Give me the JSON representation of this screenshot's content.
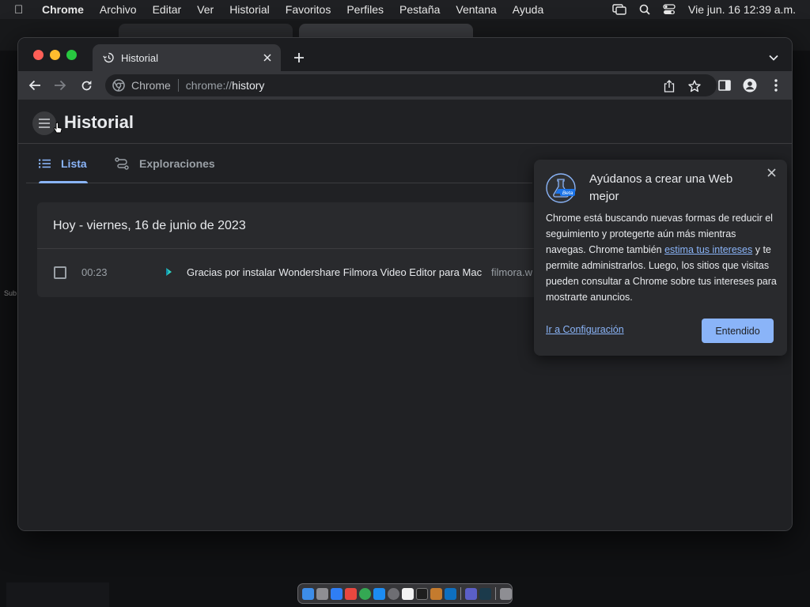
{
  "menubar": {
    "app": "Chrome",
    "items": [
      "Archivo",
      "Editar",
      "Ver",
      "Historial",
      "Favoritos",
      "Perfiles",
      "Pestaña",
      "Ventana",
      "Ayuda"
    ],
    "datetime": "Vie jun. 16  12:39 a.m."
  },
  "background": {
    "side_text": "Sub"
  },
  "window": {
    "tab": {
      "title": "Historial"
    },
    "omnibox": {
      "site_name": "Chrome",
      "url_scheme": "chrome://",
      "url_host": "history"
    }
  },
  "history": {
    "title": "Historial",
    "tabs": [
      {
        "label": "Lista",
        "active": true
      },
      {
        "label": "Exploraciones",
        "active": false
      }
    ],
    "day_header": "Hoy - viernes, 16 de junio de 2023",
    "entries": [
      {
        "time": "00:23",
        "title": "Gracias por instalar Wondershare Filmora Video Editor para Mac",
        "domain": "filmora.w"
      }
    ]
  },
  "promo": {
    "title": "Ayúdanos a crear una Web mejor",
    "logo_badge": "Beta",
    "body_before_link": "Chrome está buscando nuevas formas de reducir el seguimiento y protegerte aún más mientras navegas. Chrome también ",
    "body_link": "estima tus intereses",
    "body_after_link": " y te permite administrarlos. Luego, los sitios que visitas pueden consultar a Chrome sobre tus intereses para mostrarte anuncios.",
    "settings_link": "Ir a Configuración",
    "ok_button": "Entendido"
  },
  "colors": {
    "accent": "#8ab4f8",
    "page_bg": "#202124",
    "card_bg": "#292a2d",
    "toolbar_bg": "#35363a"
  }
}
